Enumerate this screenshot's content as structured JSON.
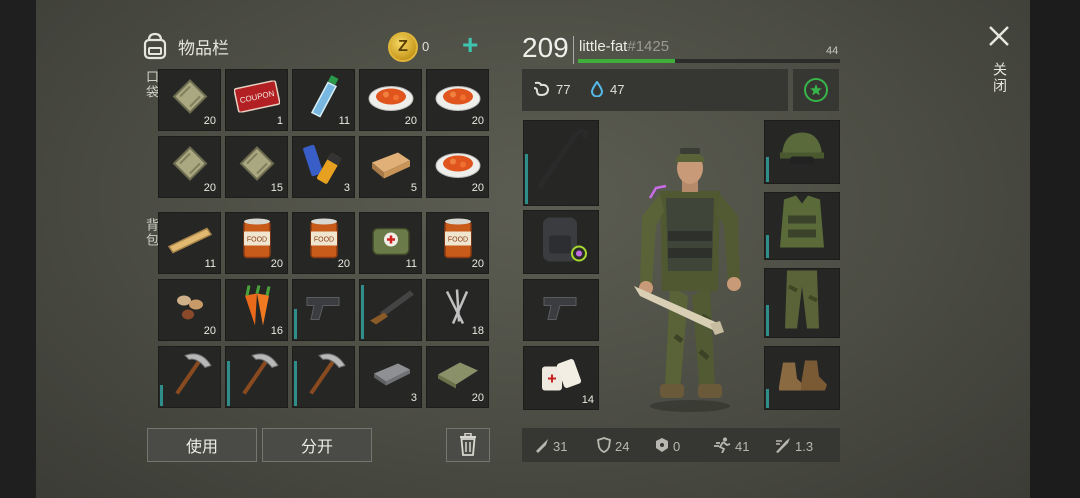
{
  "inventory": {
    "title": "物品栏",
    "coins": "0",
    "pocket_label": "口袋",
    "backpack_label": "背包",
    "pocket": [
      {
        "item": "sandbag",
        "icon": "sandbag-icon",
        "count": "20"
      },
      {
        "item": "coupon",
        "icon": "coupon-icon",
        "count": "1",
        "text": "COUPON"
      },
      {
        "item": "water-bottle",
        "icon": "water-bottle-icon",
        "count": "11"
      },
      {
        "item": "food-plate",
        "icon": "food-plate-icon",
        "count": "20"
      },
      {
        "item": "food-plate",
        "icon": "food-plate-icon",
        "count": "20"
      },
      {
        "item": "sandbag",
        "icon": "sandbag-icon",
        "count": "20"
      },
      {
        "item": "sandbag",
        "icon": "sandbag-icon",
        "count": "15"
      },
      {
        "item": "batteries",
        "icon": "battery-icon",
        "count": "3"
      },
      {
        "item": "wood-block",
        "icon": "wood-block-icon",
        "count": "5"
      },
      {
        "item": "food-plate",
        "icon": "food-plate-icon",
        "count": "20"
      }
    ],
    "backpack": [
      {
        "item": "plank",
        "icon": "plank-icon",
        "count": "11"
      },
      {
        "item": "canned-food",
        "icon": "can-icon",
        "count": "20",
        "text": "FOOD"
      },
      {
        "item": "canned-food",
        "icon": "can-icon",
        "count": "20",
        "text": "FOOD"
      },
      {
        "item": "first-aid-kit",
        "icon": "first-aid-icon",
        "count": "11"
      },
      {
        "item": "canned-food",
        "icon": "can-icon",
        "count": "20",
        "text": "FOOD"
      },
      {
        "item": "nuts",
        "icon": "nuts-icon",
        "count": "20"
      },
      {
        "item": "carrots",
        "icon": "carrot-icon",
        "count": "16"
      },
      {
        "item": "pistol",
        "icon": "pistol-icon",
        "count": "",
        "durability": 0.5
      },
      {
        "item": "shotgun",
        "icon": "shotgun-icon",
        "count": "",
        "durability": 0.9
      },
      {
        "item": "nails",
        "icon": "nails-icon",
        "count": "18"
      },
      {
        "item": "pickaxe",
        "icon": "pickaxe-icon",
        "count": "",
        "durability": 0.35
      },
      {
        "item": "pickaxe",
        "icon": "pickaxe-icon",
        "count": "",
        "durability": 0.75
      },
      {
        "item": "pickaxe",
        "icon": "pickaxe-icon",
        "count": "",
        "durability": 0.75
      },
      {
        "item": "iron-ingot",
        "icon": "iron-bar-icon",
        "count": "3"
      },
      {
        "item": "cloth",
        "icon": "cloth-icon",
        "count": "20"
      }
    ],
    "use_label": "使用",
    "split_label": "分开"
  },
  "player": {
    "level": "209",
    "name": "little-fat",
    "tag": "#1425",
    "xp_fraction": 0.37,
    "next_level": "44",
    "hunger": "77",
    "thirst": "47"
  },
  "equipment": {
    "left": [
      {
        "slot": "weapon",
        "icon": "crowbar-icon",
        "count": "",
        "durability": 0.6
      },
      {
        "slot": "backpack",
        "icon": "backpack-icon",
        "count": ""
      },
      {
        "slot": "sidearm",
        "icon": "pistol-icon",
        "count": ""
      },
      {
        "slot": "medical",
        "icon": "bandage-icon",
        "count": "14"
      }
    ],
    "right": [
      {
        "slot": "head",
        "icon": "cap-icon",
        "durability": 0.4
      },
      {
        "slot": "body",
        "icon": "vest-icon",
        "durability": 0.35
      },
      {
        "slot": "legs",
        "icon": "pants-icon",
        "durability": 0.45
      },
      {
        "slot": "feet",
        "icon": "boots-icon",
        "durability": 0.3
      }
    ]
  },
  "combat_stats": [
    {
      "icon": "damage-icon",
      "value": "31"
    },
    {
      "icon": "armor-icon",
      "value": "24"
    },
    {
      "icon": "radiation-icon",
      "value": "0"
    },
    {
      "icon": "speed-icon",
      "value": "41"
    },
    {
      "icon": "attack-speed-icon",
      "value": "1.3"
    }
  ],
  "close_label": "关闭",
  "colors": {
    "accent": "#3fc4b0",
    "xp": "#3fae3a",
    "durability": "#2f8e8a",
    "star": "#38b54a"
  }
}
